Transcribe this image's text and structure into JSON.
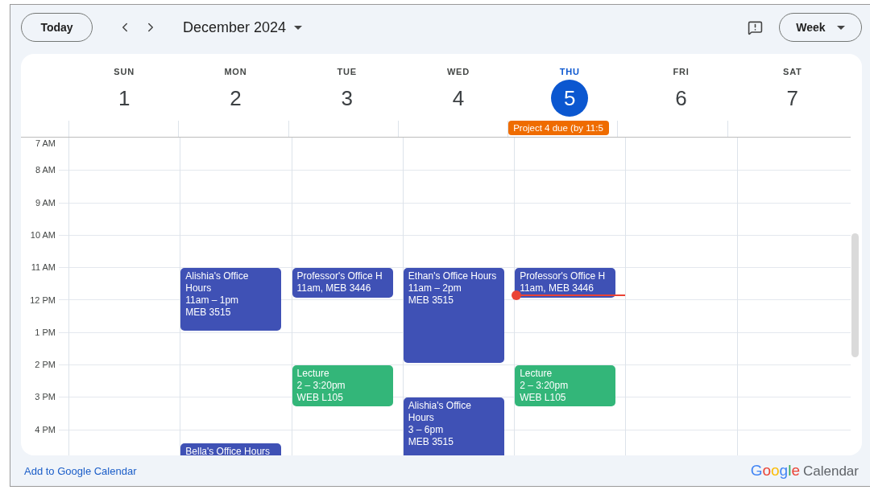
{
  "toolbar": {
    "today_button": "Today",
    "period": "December 2024",
    "view_button": "Week"
  },
  "hours": [
    "7 AM",
    "8 AM",
    "9 AM",
    "10 AM",
    "11 AM",
    "12 PM",
    "1 PM",
    "2 PM",
    "3 PM",
    "4 PM"
  ],
  "days": [
    {
      "weekday": "SUN",
      "date": "1",
      "selected": false
    },
    {
      "weekday": "MON",
      "date": "2",
      "selected": false,
      "events": [
        {
          "title": "Alishia's Office Hours",
          "lines": [
            "11am – 1pm",
            "MEB 3515"
          ],
          "color": "#3f51b5"
        },
        {
          "title": "Bella's Office Hours",
          "color": "#3f51b5"
        }
      ]
    },
    {
      "weekday": "TUE",
      "date": "3",
      "selected": false,
      "events": [
        {
          "title": "Professor's Office H",
          "lines": [
            "11am, MEB 3446"
          ],
          "color": "#3f51b5"
        },
        {
          "title": "Lecture",
          "lines": [
            "2 – 3:20pm",
            "WEB L105"
          ],
          "color": "#33b679"
        }
      ]
    },
    {
      "weekday": "WED",
      "date": "4",
      "selected": false,
      "events": [
        {
          "title": "Ethan's Office Hours",
          "lines": [
            "11am – 2pm",
            "MEB 3515"
          ],
          "color": "#3f51b5"
        },
        {
          "title": "Alishia's Office Hours",
          "lines": [
            "3 – 6pm",
            "MEB 3515"
          ],
          "color": "#3f51b5"
        }
      ]
    },
    {
      "weekday": "THU",
      "date": "5",
      "selected": true,
      "all_day": [
        {
          "title": "Project 4 due (by 11:5",
          "color": "#ef6c00"
        }
      ],
      "events": [
        {
          "title": "Professor's Office H",
          "lines": [
            "11am, MEB 3446"
          ],
          "color": "#3f51b5"
        },
        {
          "title": "Lecture",
          "lines": [
            "2 – 3:20pm",
            "WEB L105"
          ],
          "color": "#33b679"
        }
      ]
    },
    {
      "weekday": "FRI",
      "date": "6",
      "selected": false
    },
    {
      "weekday": "SAT",
      "date": "7",
      "selected": false
    }
  ],
  "footer": {
    "link": "Add to Google Calendar",
    "brand": "Google",
    "product": "Calendar"
  }
}
